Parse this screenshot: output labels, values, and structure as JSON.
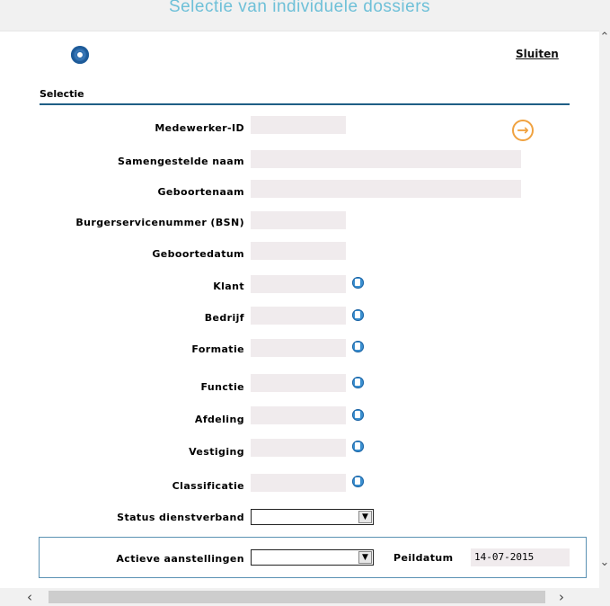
{
  "window": {
    "title": "Selectie van individuele dossiers"
  },
  "header": {
    "close_label": "Sluiten"
  },
  "section": {
    "title": "Selectie"
  },
  "fields": {
    "medewerker_id": {
      "label": "Medewerker-ID",
      "value": ""
    },
    "samengestelde_naam": {
      "label": "Samengestelde naam",
      "value": ""
    },
    "geboortenaam": {
      "label": "Geboortenaam",
      "value": ""
    },
    "bsn": {
      "label": "Burgerservicenummer (BSN)",
      "value": ""
    },
    "geboortedatum": {
      "label": "Geboortedatum",
      "value": ""
    },
    "klant": {
      "label": "Klant",
      "value": ""
    },
    "bedrijf": {
      "label": "Bedrijf",
      "value": ""
    },
    "formatie": {
      "label": "Formatie",
      "value": ""
    },
    "functie": {
      "label": "Functie",
      "value": ""
    },
    "afdeling": {
      "label": "Afdeling",
      "value": ""
    },
    "vestiging": {
      "label": "Vestiging",
      "value": ""
    },
    "classificatie": {
      "label": "Classificatie",
      "value": ""
    },
    "status_dienstverband": {
      "label": "Status dienstverband",
      "value": ""
    }
  },
  "aanstellingen": {
    "label": "Actieve aanstellingen",
    "value": "",
    "peildatum_label": "Peildatum",
    "peildatum_value": "14-07-2015"
  },
  "icons": {
    "logo": "gear-logo-icon",
    "go": "arrow-right-circle-icon",
    "lookup": "lookup-icon",
    "dropdown": "chevron-down-icon"
  },
  "colors": {
    "title": "#6ec0d8",
    "section_line": "#1f5f85",
    "input_bg": "#f0ebed",
    "go_button": "#f0a240",
    "box_border": "#5b92b3"
  }
}
